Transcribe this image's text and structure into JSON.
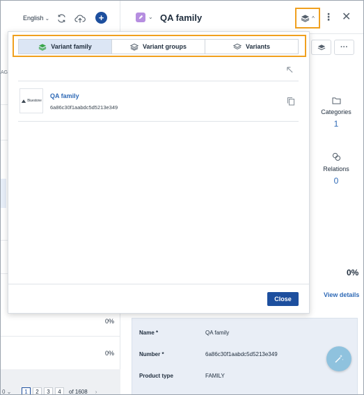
{
  "left": {
    "language": "English",
    "fragment_label": "AG",
    "percent_rows": [
      "0%",
      "0%"
    ],
    "pagination": {
      "pages": [
        "1",
        "2",
        "3",
        "4"
      ],
      "active_page": "1",
      "of_text": "of 1608"
    }
  },
  "header": {
    "title": "QA family",
    "icons": [
      "pencil-icon",
      "chevron-down-icon",
      "layers-icon",
      "chevron-up-icon",
      "kebab-icon",
      "close-icon"
    ]
  },
  "right": {
    "stats": [
      {
        "label": "Categories",
        "value": "1",
        "icon": "folder-icon"
      },
      {
        "label": "Relations",
        "value": "0",
        "icon": "link-icon"
      }
    ],
    "completeness": "0%",
    "view_details": "View details",
    "info": [
      {
        "key": "Name *",
        "value": "QA family"
      },
      {
        "key": "Number *",
        "value": "6a86c30f1aabdc5d5213e349"
      },
      {
        "key": "Product type",
        "value": "FAMILY"
      }
    ]
  },
  "modal": {
    "tabs": [
      {
        "label": "Variant family",
        "icon": "layers-icon",
        "active": true
      },
      {
        "label": "Variant groups",
        "icon": "layers-icon",
        "active": false
      },
      {
        "label": "Variants",
        "icon": "layers-icon",
        "active": false
      }
    ],
    "family": {
      "name": "QA family",
      "id": "6a86c30f1aabdc5d5213e349",
      "logo_text": "Bluestone"
    },
    "close_label": "Close"
  },
  "colors": {
    "accent": "#1d4f9e",
    "highlight": "#f0a01e",
    "link": "#2f6ab6",
    "active_tab": "#dce6f5"
  }
}
